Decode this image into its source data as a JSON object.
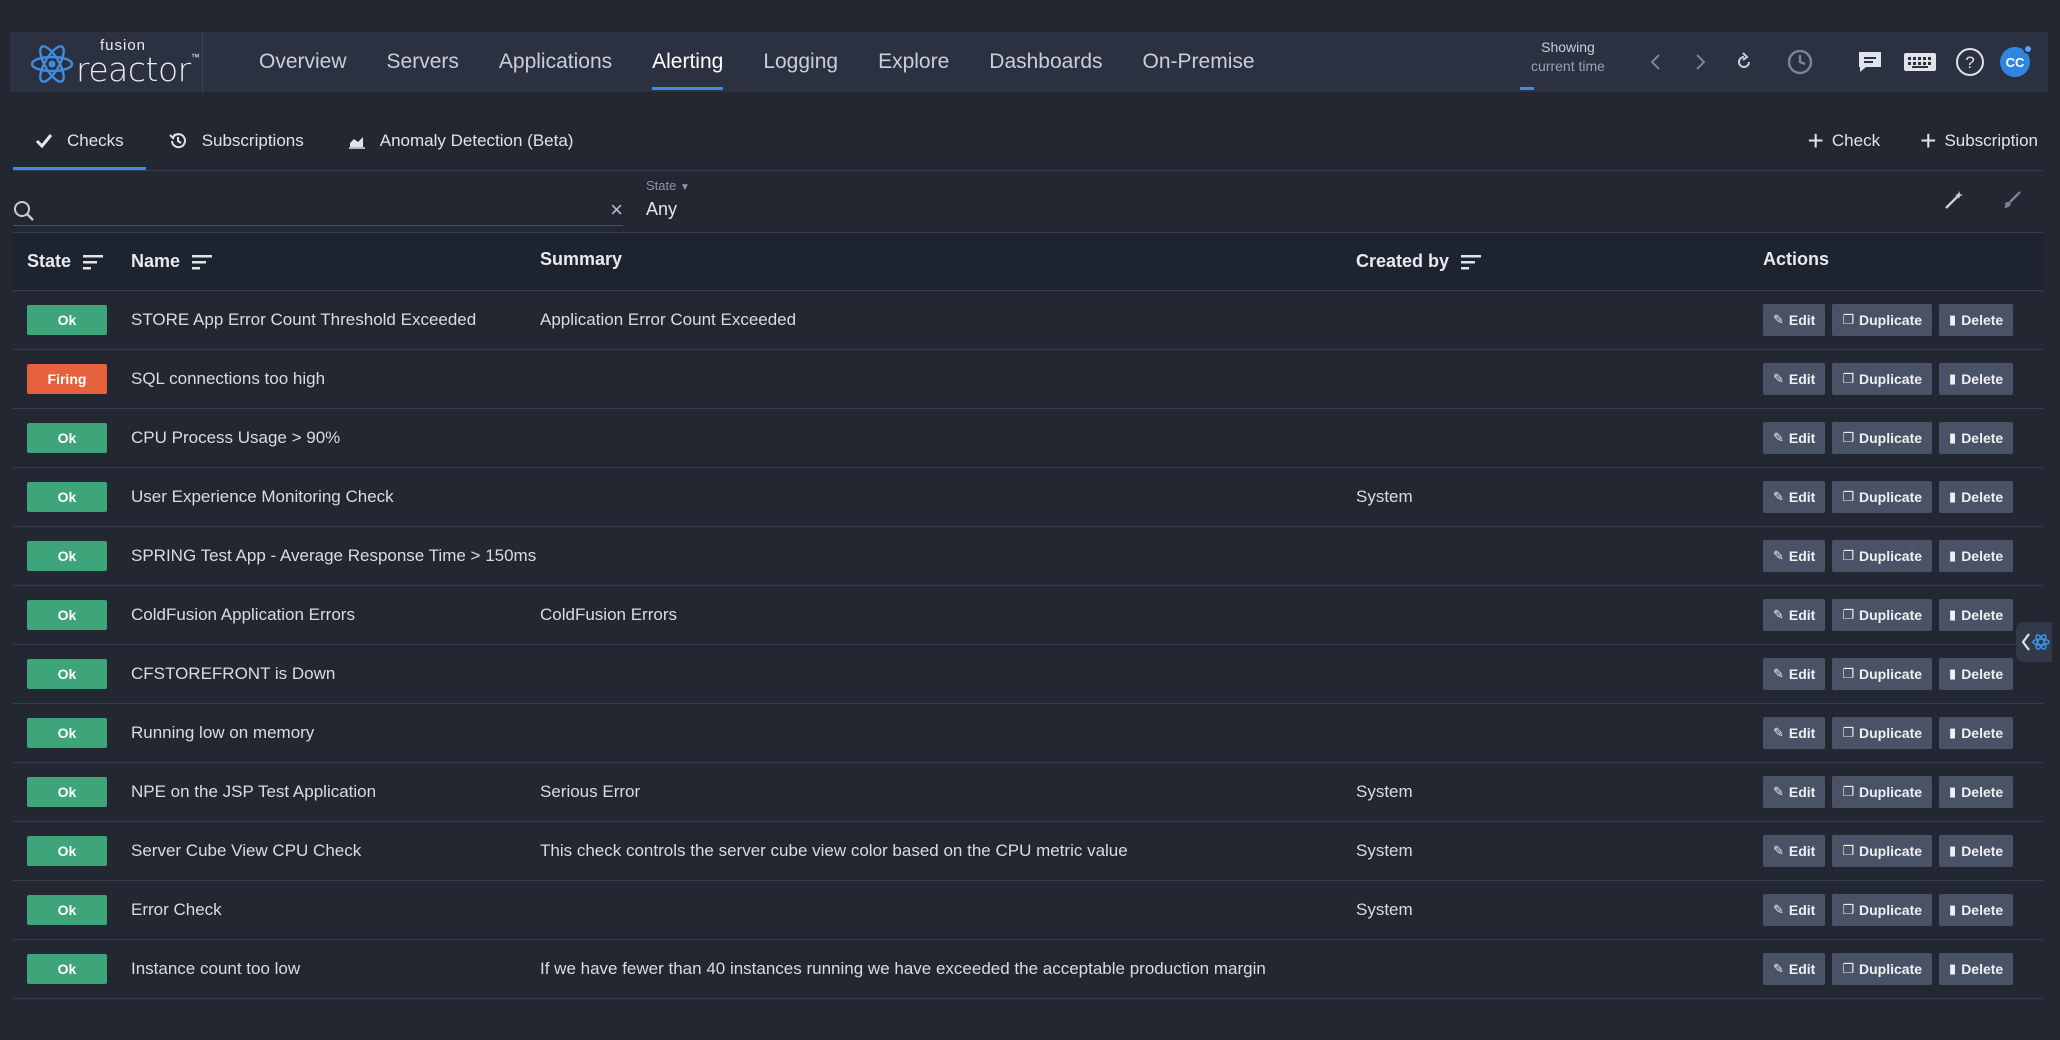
{
  "logo": {
    "top": "fusion",
    "main": "reactor",
    "tm": "™"
  },
  "nav": {
    "items": [
      {
        "label": "Overview",
        "active": false
      },
      {
        "label": "Servers",
        "active": false
      },
      {
        "label": "Applications",
        "active": false
      },
      {
        "label": "Alerting",
        "active": true
      },
      {
        "label": "Logging",
        "active": false
      },
      {
        "label": "Explore",
        "active": false
      },
      {
        "label": "Dashboards",
        "active": false
      },
      {
        "label": "On-Premise",
        "active": false
      }
    ],
    "showing_label": "Showing",
    "showing_value": "current time",
    "avatar_initials": "CC"
  },
  "subtabs": [
    {
      "label": "Checks",
      "icon": "check-icon"
    },
    {
      "label": "Subscriptions",
      "icon": "history-icon"
    },
    {
      "label": "Anomaly Detection (Beta)",
      "icon": "area-chart-icon"
    }
  ],
  "create": {
    "check": "Check",
    "subscription": "Subscription"
  },
  "filter": {
    "search_value": "",
    "clear": "×",
    "state_label": "State",
    "state_value": "Any"
  },
  "table": {
    "headers": {
      "state": "State",
      "name": "Name",
      "summary": "Summary",
      "created_by": "Created by",
      "actions": "Actions"
    },
    "action_labels": {
      "edit": "Edit",
      "duplicate": "Duplicate",
      "delete": "Delete"
    },
    "rows": [
      {
        "state": "Ok",
        "name": "STORE App Error Count Threshold Exceeded",
        "summary": "Application Error Count Exceeded",
        "created_by": ""
      },
      {
        "state": "Firing",
        "name": "SQL connections too high",
        "summary": "",
        "created_by": ""
      },
      {
        "state": "Ok",
        "name": "CPU Process Usage > 90%",
        "summary": "",
        "created_by": ""
      },
      {
        "state": "Ok",
        "name": "User Experience Monitoring Check",
        "summary": "",
        "created_by": "System"
      },
      {
        "state": "Ok",
        "name": "SPRING Test App - Average Response Time > 150ms",
        "summary": "",
        "created_by": ""
      },
      {
        "state": "Ok",
        "name": "ColdFusion Application Errors",
        "summary": "ColdFusion Errors",
        "created_by": ""
      },
      {
        "state": "Ok",
        "name": "CFSTOREFRONT is Down",
        "summary": "",
        "created_by": ""
      },
      {
        "state": "Ok",
        "name": "Running low on memory",
        "summary": "",
        "created_by": ""
      },
      {
        "state": "Ok",
        "name": "NPE on the JSP Test Application",
        "summary": "Serious Error",
        "created_by": "System"
      },
      {
        "state": "Ok",
        "name": "Server Cube View CPU Check",
        "summary": "This check controls the server cube view color based on the CPU metric value",
        "created_by": "System"
      },
      {
        "state": "Ok",
        "name": "Error Check",
        "summary": "",
        "created_by": "System"
      },
      {
        "state": "Ok",
        "name": "Instance count too low",
        "summary": "If we have fewer than 40 instances running we have exceeded the acceptable production margin",
        "created_by": ""
      }
    ]
  },
  "colors": {
    "accent": "#3f8de0",
    "ok": "#3ea57b",
    "firing": "#e5623d",
    "background": "#222732"
  }
}
